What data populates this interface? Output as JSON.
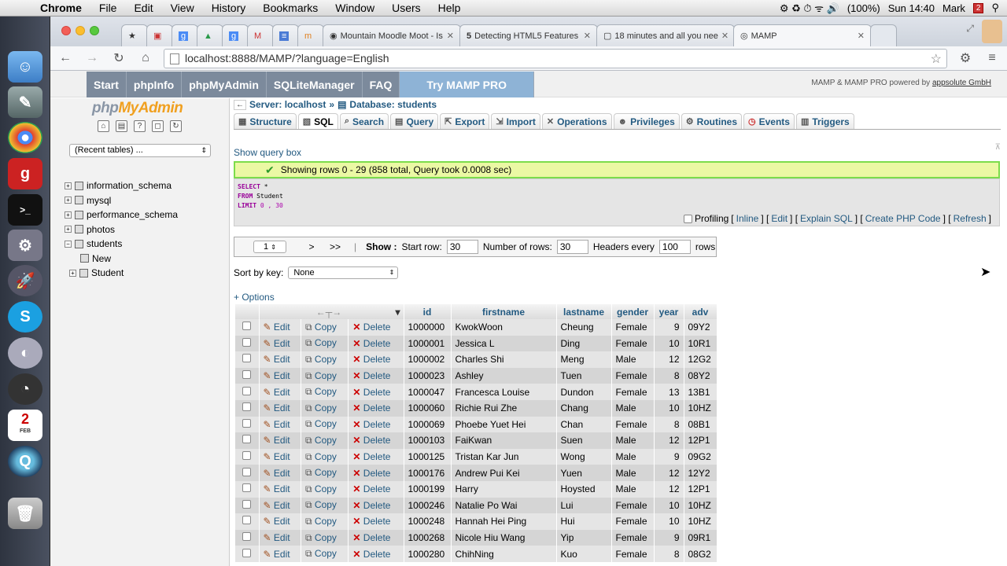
{
  "menubar": {
    "app": "Chrome",
    "items": [
      "File",
      "Edit",
      "View",
      "History",
      "Bookmarks",
      "Window",
      "Users",
      "Help"
    ],
    "battery": "(100%)",
    "clock": "Sun 14:40",
    "user": "Mark"
  },
  "tabs": [
    {
      "label": "Mountain Moodle Moot - Is"
    },
    {
      "label": "Detecting HTML5 Features"
    },
    {
      "label": "18 minutes and all you nee"
    },
    {
      "label": "MAMP"
    }
  ],
  "address": {
    "url": "localhost:8888/MAMP/?language=English"
  },
  "mamp": {
    "nav": [
      "Start",
      "phpInfo",
      "phpMyAdmin",
      "SQLiteManager",
      "FAQ"
    ],
    "pro": "Try MAMP PRO",
    "powered": "MAMP & MAMP PRO powered by",
    "company": "appsolute GmbH"
  },
  "sidebar": {
    "logo_php": "php",
    "logo_admin": "MyAdmin",
    "recent": "(Recent tables) ...",
    "dbs": [
      "information_schema",
      "mysql",
      "performance_schema",
      "photos",
      "students"
    ],
    "tables": [
      "New",
      "Student"
    ]
  },
  "breadcrumb": {
    "server": "Server: localhost",
    "sep": "»",
    "database": "Database: students"
  },
  "menu": [
    "Structure",
    "SQL",
    "Search",
    "Query",
    "Export",
    "Import",
    "Operations",
    "Privileges",
    "Routines",
    "Events",
    "Triggers"
  ],
  "query": {
    "show_box": "Show query box",
    "success": "Showing rows 0 - 29 (858 total, Query took 0.0008 sec)",
    "sql_select": "SELECT",
    "sql_star": "*",
    "sql_from": "FROM",
    "sql_table": "Student",
    "sql_limit": "LIMIT",
    "sql_limit_vals": "0 , 30",
    "profiling": "Profiling",
    "links": [
      "Inline",
      "Edit",
      "Explain SQL",
      "Create PHP Code",
      "Refresh"
    ]
  },
  "nav": {
    "page": "1",
    "next": ">",
    "last": ">>",
    "show": "Show :",
    "start_row_label": "Start row:",
    "start_row": "30",
    "num_rows_label": "Number of rows:",
    "num_rows": "30",
    "headers_label": "Headers every",
    "headers_every": "100",
    "rows_label": "rows"
  },
  "sort": {
    "label": "Sort by key:",
    "value": "None"
  },
  "options": "+ Options",
  "table": {
    "columns": [
      "id",
      "firstname",
      "lastname",
      "gender",
      "year",
      "adv"
    ],
    "actions": {
      "edit": "Edit",
      "copy": "Copy",
      "delete": "Delete"
    },
    "rows": [
      [
        "1000000",
        "KwokWoon",
        "Cheung",
        "Female",
        "9",
        "09Y2"
      ],
      [
        "1000001",
        "Jessica L",
        "Ding",
        "Female",
        "10",
        "10R1"
      ],
      [
        "1000002",
        "Charles Shi",
        "Meng",
        "Male",
        "12",
        "12G2"
      ],
      [
        "1000023",
        "Ashley",
        "Tuen",
        "Female",
        "8",
        "08Y2"
      ],
      [
        "1000047",
        "Francesca Louise",
        "Dundon",
        "Female",
        "13",
        "13B1"
      ],
      [
        "1000060",
        "Richie Rui Zhe",
        "Chang",
        "Male",
        "10",
        "10HZ"
      ],
      [
        "1000069",
        "Phoebe Yuet Hei",
        "Chan",
        "Female",
        "8",
        "08B1"
      ],
      [
        "1000103",
        "FaiKwan",
        "Suen",
        "Male",
        "12",
        "12P1"
      ],
      [
        "1000125",
        "Tristan Kar Jun",
        "Wong",
        "Male",
        "9",
        "09G2"
      ],
      [
        "1000176",
        "Andrew Pui Kei",
        "Yuen",
        "Male",
        "12",
        "12Y2"
      ],
      [
        "1000199",
        "Harry",
        "Hoysted",
        "Male",
        "12",
        "12P1"
      ],
      [
        "1000246",
        "Natalie Po Wai",
        "Lui",
        "Female",
        "10",
        "10HZ"
      ],
      [
        "1000248",
        "Hannah Hei Ping",
        "Hui",
        "Female",
        "10",
        "10HZ"
      ],
      [
        "1000268",
        "Nicole Hiu Wang",
        "Yip",
        "Female",
        "9",
        "09R1"
      ],
      [
        "1000280",
        "ChihNing",
        "Kuo",
        "Female",
        "8",
        "08G2"
      ]
    ]
  },
  "dock": {
    "calendar_day": "2",
    "calendar_month": "FEB"
  }
}
